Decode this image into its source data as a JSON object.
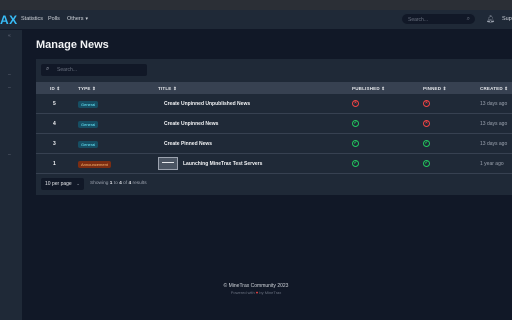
{
  "app": {
    "logo": "AX",
    "user": "Sup"
  },
  "nav": {
    "statistics": "Statistics",
    "polls": "Polls",
    "others": "Others",
    "search_placeholder": "Search..."
  },
  "page": {
    "title": "Manage News"
  },
  "table": {
    "search_placeholder": "Search...",
    "headers": {
      "id": "ID",
      "type": "TYPE",
      "title": "TITLE",
      "published": "PUBLISHED",
      "pinned": "PINNED",
      "created": "CREATED"
    },
    "rows": [
      {
        "id": "5",
        "type": "General",
        "title": "Create Unpinned Unpublished News",
        "published": false,
        "pinned": false,
        "created": "13 days ago"
      },
      {
        "id": "4",
        "type": "General",
        "title": "Create Unpinned News",
        "published": true,
        "pinned": false,
        "created": "13 days ago"
      },
      {
        "id": "3",
        "type": "General",
        "title": "Create Pinned News",
        "published": true,
        "pinned": true,
        "created": "13 days ago"
      },
      {
        "id": "1",
        "type": "Announcement",
        "title": "Launching MineTrax Test Servers",
        "published": true,
        "pinned": true,
        "created": "1 year ago"
      }
    ]
  },
  "pagination": {
    "per_page": "10 per page",
    "showing_prefix": "Showing",
    "from": "1",
    "to_word": "to",
    "to": "4",
    "of_word": "of",
    "total": "4",
    "results_word": "results"
  },
  "footer": {
    "copyright": "© MineTrax Community 2023",
    "powered_prefix": "Powered with",
    "powered_suffix": "by MineTrax"
  },
  "colors": {
    "accent": "#38bdf8",
    "red": "#ef4444",
    "green": "#22c55e"
  }
}
